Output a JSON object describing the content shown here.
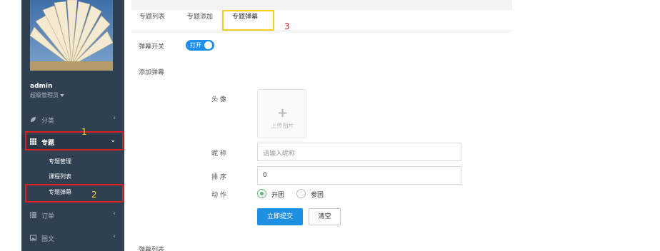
{
  "sidebar": {
    "profile": {
      "name": "admin",
      "role": "超级管理员"
    },
    "nav": {
      "category": {
        "label": "分类"
      },
      "topic": {
        "label": "专题"
      },
      "topic_manage": "专题管理",
      "course_list": "课程列表",
      "topic_popup": "专题弹幕",
      "order": {
        "label": "订单"
      },
      "article": {
        "label": "图文"
      }
    }
  },
  "tabs": {
    "list": "专题列表",
    "add": "专题添加",
    "popup": "专题弹幕"
  },
  "annotations": {
    "one": "1",
    "two": "2",
    "three": "3"
  },
  "form": {
    "switch_label": "弹幕开关",
    "switch_text": "打开",
    "section_add": "添加弹幕",
    "avatar_label": "头 像",
    "upload_text": "上传图片",
    "nickname_label": "昵 称",
    "nickname_placeholder": "请输入昵称",
    "order_label": "排 序",
    "order_value": "0",
    "action_label": "动 作",
    "action_open": "开团",
    "action_join": "参团",
    "submit": "立即提交",
    "reset": "清空",
    "section_list": "弹幕列表"
  },
  "colors": {
    "sidebar": "#2f4050",
    "primary": "#1e8fe1",
    "annot_red": "#e02020",
    "annot_yellow": "#f3d11e"
  }
}
